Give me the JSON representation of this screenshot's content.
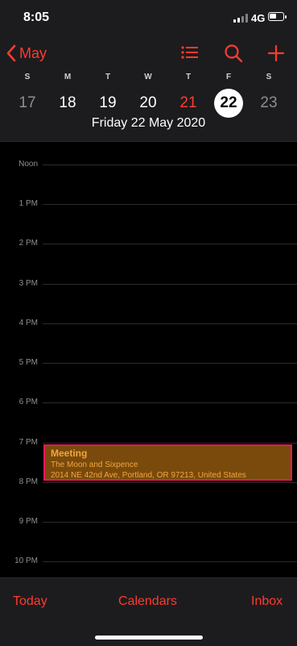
{
  "status_bar": {
    "time": "8:05",
    "network": "4G"
  },
  "header": {
    "back_label": "May",
    "icons": [
      "list-icon",
      "search-icon",
      "plus-icon"
    ],
    "weekdays": [
      "S",
      "M",
      "T",
      "W",
      "T",
      "F",
      "S"
    ],
    "dates": [
      "17",
      "18",
      "19",
      "20",
      "21",
      "22",
      "23"
    ],
    "today_date": "21",
    "selected_date": "22",
    "full_date": "Friday  22 May 2020"
  },
  "timeline": {
    "hours": [
      "Noon",
      "1 PM",
      "2 PM",
      "3 PM",
      "4 PM",
      "5 PM",
      "6 PM",
      "7 PM",
      "8 PM",
      "9 PM",
      "10 PM"
    ]
  },
  "event": {
    "title": "Meeting",
    "location": "The Moon and Sixpence",
    "address": "2014 NE 42nd Ave, Portland, OR  97213, United States"
  },
  "tab_bar": {
    "today": "Today",
    "calendars": "Calendars",
    "inbox": "Inbox"
  },
  "colors": {
    "accent": "#ff3b30",
    "event_fill": "#7a4a0c",
    "event_text": "#f2a63c",
    "highlight": "#e8185a"
  }
}
